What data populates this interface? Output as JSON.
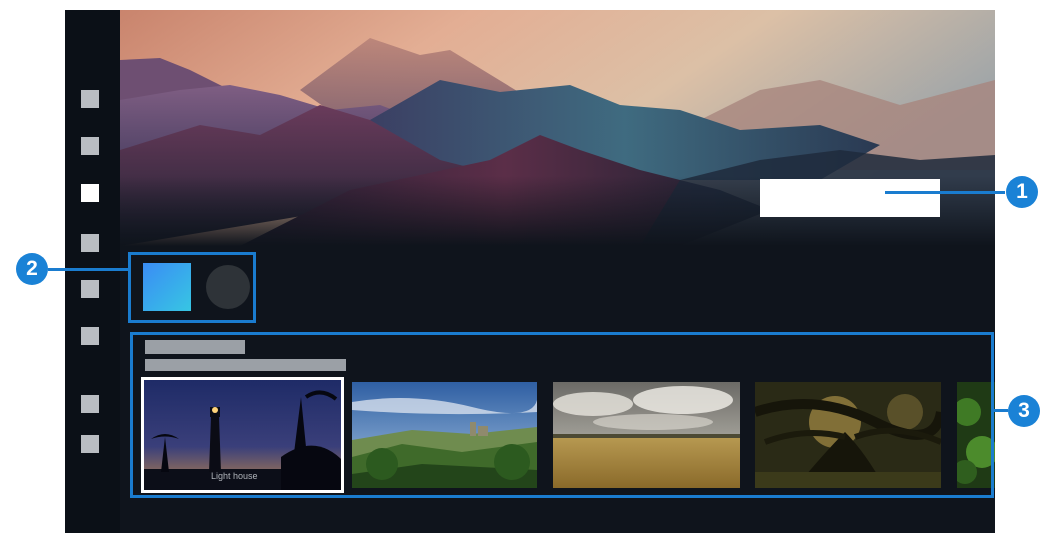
{
  "sidebar": {
    "items": [
      {
        "name": "nav-item-1",
        "active": false
      },
      {
        "name": "nav-item-2",
        "active": false
      },
      {
        "name": "nav-item-3",
        "active": true
      },
      {
        "name": "nav-item-4",
        "active": false
      },
      {
        "name": "nav-item-5",
        "active": false
      },
      {
        "name": "nav-item-6",
        "active": false
      },
      {
        "name": "nav-item-7",
        "active": false
      },
      {
        "name": "nav-item-8",
        "active": false
      }
    ]
  },
  "hero": {
    "image": "mountain-landscape-gradient"
  },
  "quick_access": {
    "tiles": [
      {
        "icon": "app-tile-blue-gradient"
      },
      {
        "icon": "app-tile-dark-circle"
      }
    ]
  },
  "content_row": {
    "thumbnails": [
      {
        "image": "lighthouse-at-night",
        "caption": "Light house",
        "selected": true
      },
      {
        "image": "green-valley-village",
        "caption": "",
        "selected": false
      },
      {
        "image": "golden-field-under-clouds",
        "caption": "",
        "selected": false
      },
      {
        "image": "dark-forest-tree",
        "caption": "",
        "selected": false
      },
      {
        "image": "green-foliage",
        "caption": "",
        "selected": false
      }
    ]
  },
  "callouts": {
    "marker_1": "1",
    "marker_2": "2",
    "marker_3": "3"
  },
  "colors": {
    "callout": "#1a7ccf",
    "background": "#0f141c",
    "sidebar": "#0b1017"
  }
}
